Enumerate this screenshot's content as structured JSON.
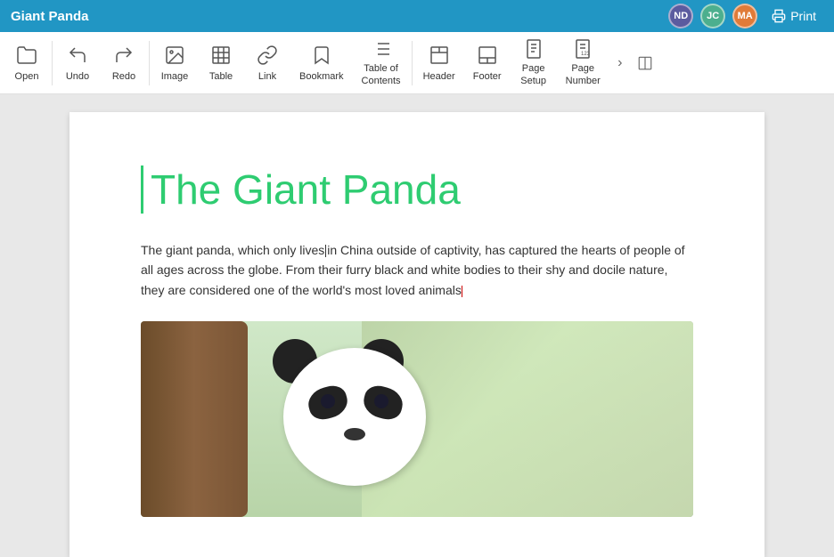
{
  "app": {
    "title": "Giant Panda"
  },
  "titlebar": {
    "avatars": [
      {
        "initials": "ND",
        "class": "avatar-nd"
      },
      {
        "initials": "JC",
        "class": "avatar-jc"
      },
      {
        "initials": "MA",
        "class": "avatar-ma"
      }
    ],
    "print_label": "Print"
  },
  "toolbar": {
    "items": [
      {
        "id": "open",
        "label": "Open",
        "icon": "folder"
      },
      {
        "id": "undo",
        "label": "Undo",
        "icon": "undo"
      },
      {
        "id": "redo",
        "label": "Redo",
        "icon": "redo"
      },
      {
        "id": "image",
        "label": "Image",
        "icon": "image"
      },
      {
        "id": "table",
        "label": "Table",
        "icon": "table"
      },
      {
        "id": "link",
        "label": "Link",
        "icon": "link"
      },
      {
        "id": "bookmark",
        "label": "Bookmark",
        "icon": "bookmark"
      },
      {
        "id": "toc",
        "label": "Table of\nContents",
        "icon": "toc"
      },
      {
        "id": "header",
        "label": "Header",
        "icon": "header"
      },
      {
        "id": "footer",
        "label": "Footer",
        "icon": "footer"
      },
      {
        "id": "page-setup",
        "label": "Page\nSetup",
        "icon": "page-setup"
      },
      {
        "id": "page-number",
        "label": "Page\nNumber",
        "icon": "page-number"
      }
    ],
    "nav_next": ">",
    "window_icon": "⬜"
  },
  "document": {
    "title": "The Giant Panda",
    "body_text": "The giant panda, which only lives in China outside of captivity, has captured the hearts of people of all ages across the globe. From their furry black and white bodies to their shy and docile nature, they are considered one of the world's most loved animals."
  }
}
